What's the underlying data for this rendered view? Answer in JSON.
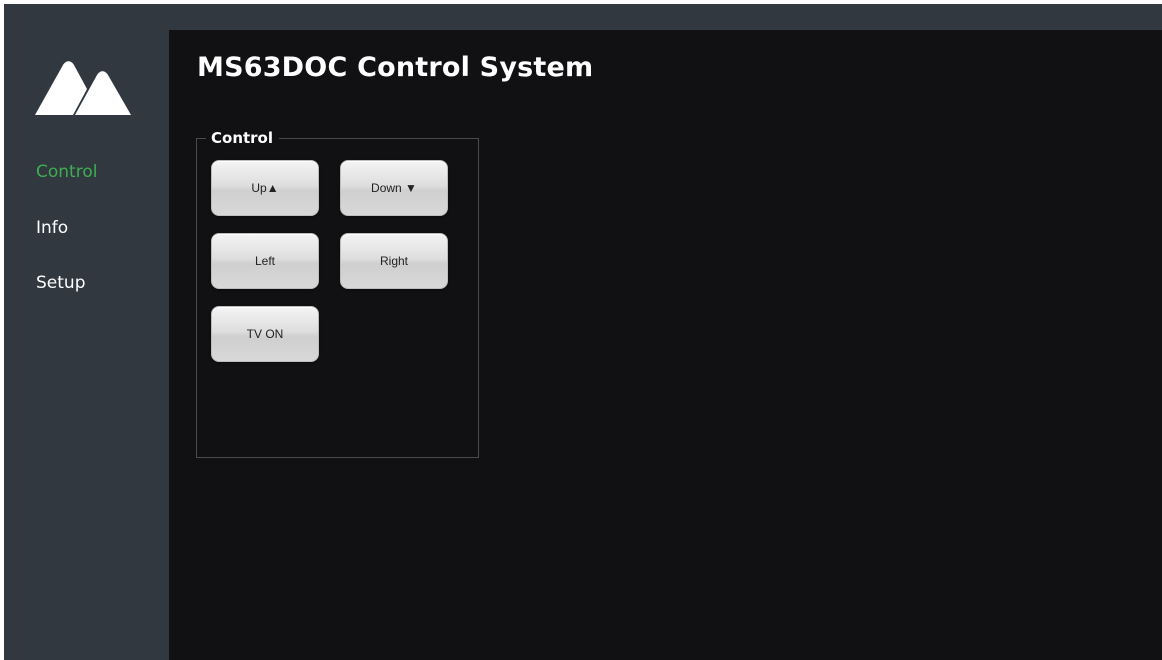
{
  "app": {
    "title": "MS63DOC Control System",
    "brand_color": "#ffffff",
    "accent_color": "#3fae4f"
  },
  "logo": {
    "icon": "brand-logo-icon"
  },
  "sidebar": {
    "items": [
      {
        "label": "Control",
        "active": true
      },
      {
        "label": "Info",
        "active": false
      },
      {
        "label": "Setup",
        "active": false
      }
    ]
  },
  "control_panel": {
    "legend": "Control",
    "buttons": [
      {
        "label": "Up▲"
      },
      {
        "label": "Down ▼"
      },
      {
        "label": "Left"
      },
      {
        "label": "Right"
      },
      {
        "label": "TV ON"
      }
    ]
  }
}
